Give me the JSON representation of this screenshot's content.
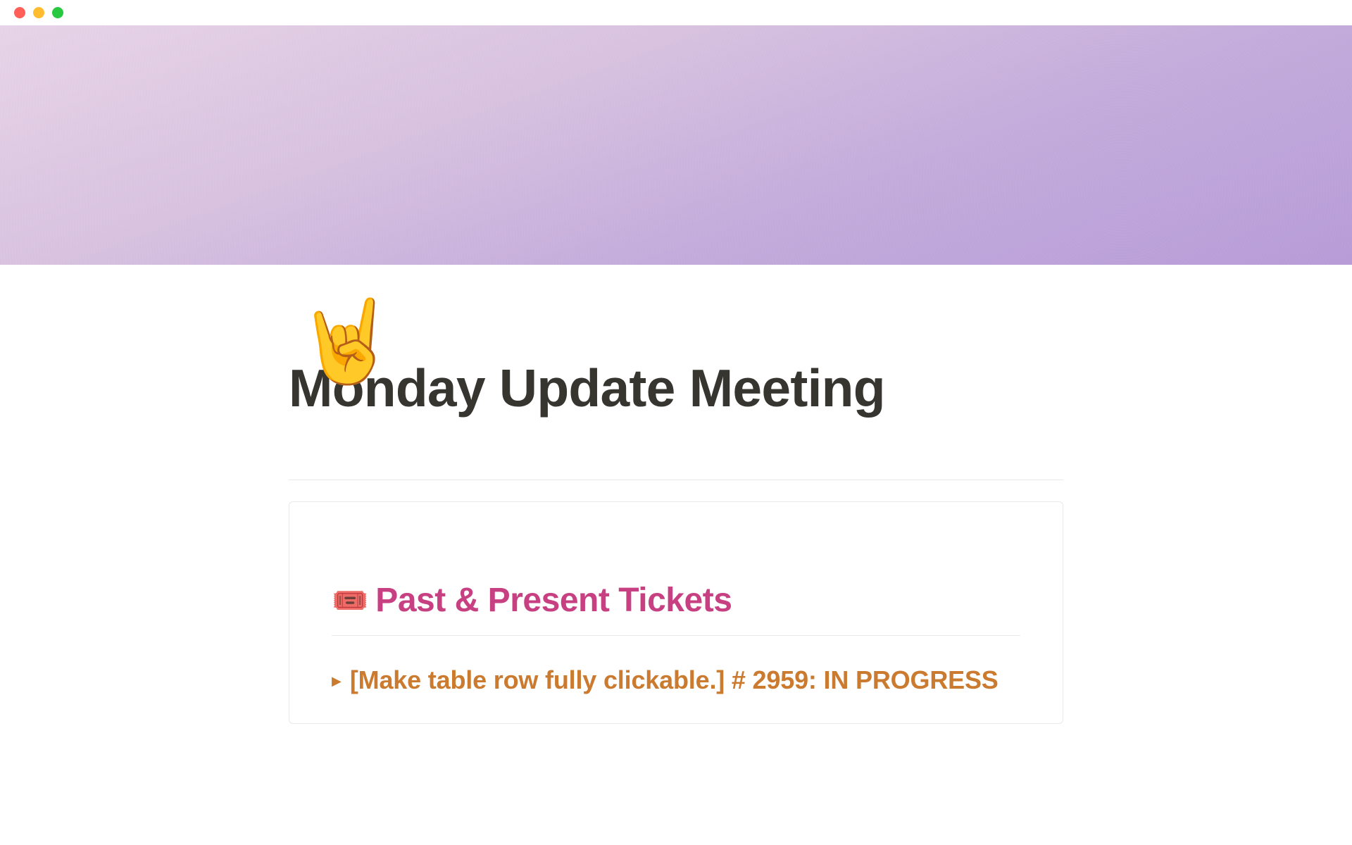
{
  "page": {
    "icon_emoji": "🤘",
    "title": "Monday Update Meeting"
  },
  "section": {
    "icon_emoji": "🎟️",
    "title": "Past & Present Tickets"
  },
  "tickets": [
    {
      "label": "[Make table row fully clickable.] # 2959: IN PROGRESS"
    }
  ]
}
